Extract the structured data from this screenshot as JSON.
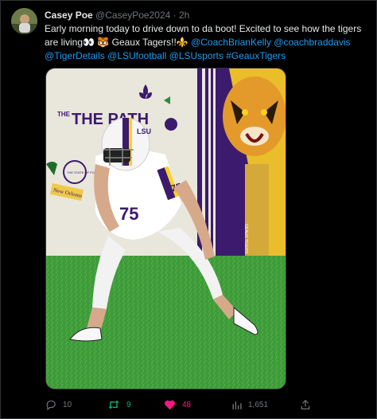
{
  "tweet": {
    "author_name": "Casey Poe",
    "handle": "@CaseyPoe2024",
    "separator": "·",
    "time": "2h",
    "text_part1": "Early morning today to drive down to da boot! Excited to see how the tigers are living",
    "emoji1": "👀",
    "emoji2": "🐯",
    "text_part2": " Geaux Tagers!!",
    "emoji3": "⚜️",
    "mentions_line1": "@CoachBrianKelly @coachbraddavis",
    "mentions_line2": "@TigerDetails @LSUfootball @LSUsports #GeauxTigers"
  },
  "photo": {
    "wall_text": "THE PATH",
    "sign_text": "New Orleans",
    "side_text": "GEAUX TIGERS",
    "jersey_number": "75",
    "jersey_label": "LSU",
    "circle_text": "THE STATE OF FOOTBALL"
  },
  "actions": {
    "replies": "10",
    "retweets": "9",
    "likes": "48",
    "views": "1,651"
  },
  "icons": {
    "reply": "reply-icon",
    "retweet": "retweet-icon",
    "like": "heart-icon",
    "views": "views-chart-icon",
    "share": "share-icon"
  },
  "colors": {
    "background": "#000000",
    "link": "#1d9bf0",
    "muted": "#71767b",
    "retweet_active": "#00ba7c",
    "like_active": "#f91880",
    "lsu_purple": "#461d7c",
    "lsu_gold": "#fdd023"
  }
}
